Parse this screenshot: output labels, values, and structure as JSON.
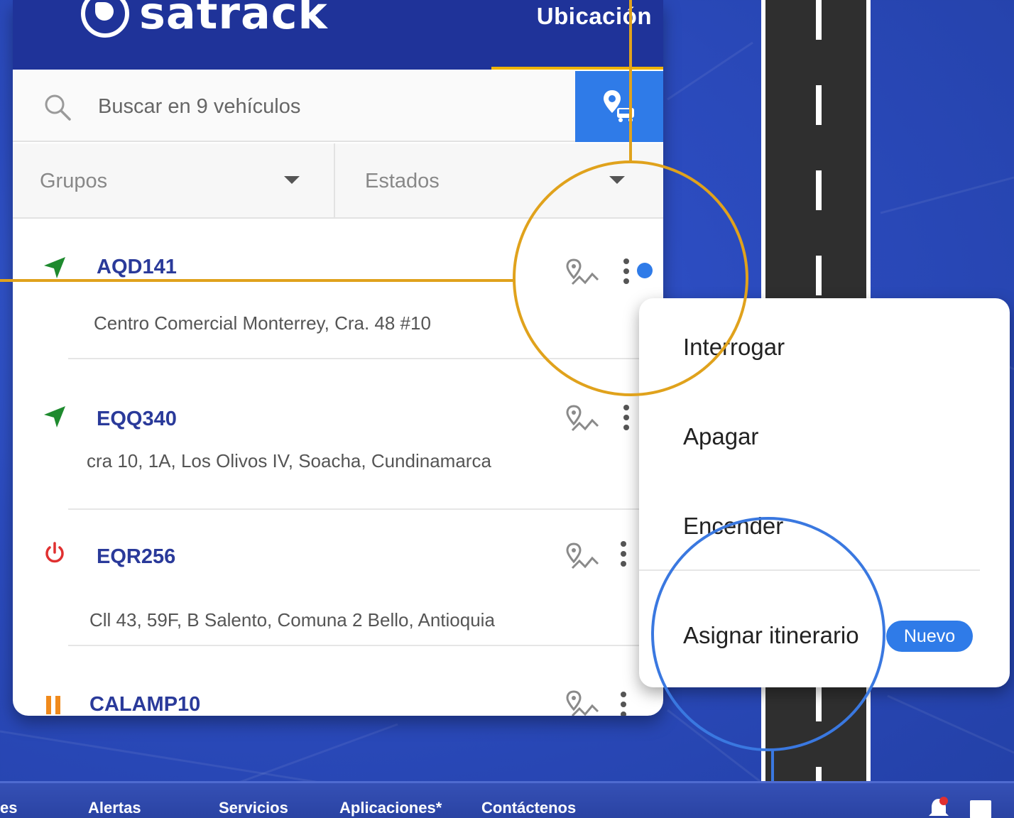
{
  "brand": {
    "name": "satrack"
  },
  "header": {
    "title": "Ubicación"
  },
  "search": {
    "placeholder": "Buscar en 9 vehículos",
    "value": ""
  },
  "filters": {
    "groups_label": "Grupos",
    "states_label": "Estados"
  },
  "vehicles": [
    {
      "plate": "AQD141",
      "address": "Centro Comercial Monterrey, Cra. 48 #10",
      "status": "moving",
      "status_icon": "navigation-arrow-icon",
      "status_color": "#1e8a2e",
      "selected": true
    },
    {
      "plate": "EQQ340",
      "address": "cra 10, 1A,  Los Olivos IV, Soacha, Cundinamarca",
      "status": "moving",
      "status_icon": "navigation-arrow-icon",
      "status_color": "#1e8a2e"
    },
    {
      "plate": "EQR256",
      "address": "Cll 43, 59F, B Salento, Comuna 2 Bello, Antioquia",
      "status": "off",
      "status_icon": "power-icon",
      "status_color": "#e03030"
    },
    {
      "plate": "CALAMP10",
      "address": "",
      "status": "paused",
      "status_icon": "pause-icon",
      "status_color": "#f08a1c"
    }
  ],
  "context_menu": {
    "items": [
      "Interrogar",
      "Apagar",
      "Encender",
      "Asignar itinerario"
    ],
    "badge": "Nuevo"
  },
  "bottom_nav": {
    "items": [
      "es",
      "Alertas",
      "Servicios",
      "Aplicaciones*",
      "Contáctenos"
    ]
  },
  "colors": {
    "header": "#1f3399",
    "accent_blue": "#2f7be8",
    "accent_yellow": "#f0b400",
    "plate_text": "#2a3a9a",
    "callout_orange": "#e0a21c",
    "callout_blue": "#3a78e0"
  }
}
